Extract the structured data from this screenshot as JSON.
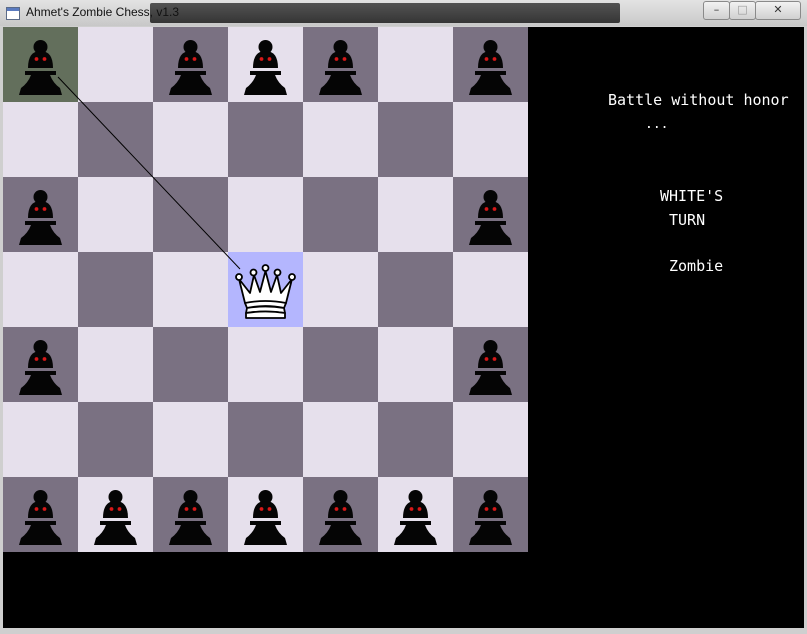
{
  "window": {
    "title": "Ahmet's Zombie Chess, v1.3",
    "controls": {
      "minimize": "–",
      "maximize": "□",
      "close": "✕"
    }
  },
  "colors": {
    "light_square": "#e6e0ec",
    "dark_square": "#7a7182",
    "last_move_square": "#636f5c",
    "selected_square": "#b4b6fe",
    "zombie_eyes": "#d81818"
  },
  "board": {
    "columns": 7,
    "rows": 7,
    "squares": [
      [
        "zombie-hl",
        "empty",
        "zombie",
        "zombie",
        "zombie",
        "empty",
        "zombie"
      ],
      [
        "empty",
        "empty",
        "empty",
        "empty",
        "empty",
        "empty",
        "empty"
      ],
      [
        "zombie",
        "empty",
        "empty",
        "empty",
        "empty",
        "empty",
        "zombie"
      ],
      [
        "empty",
        "empty",
        "empty",
        "queen-sel",
        "empty",
        "empty",
        "empty"
      ],
      [
        "zombie",
        "empty",
        "empty",
        "empty",
        "empty",
        "empty",
        "zombie"
      ],
      [
        "empty",
        "empty",
        "empty",
        "empty",
        "empty",
        "empty",
        "empty"
      ],
      [
        "zombie",
        "zombie",
        "zombie",
        "zombie",
        "zombie",
        "zombie",
        "zombie"
      ]
    ],
    "last_move": {
      "from": [
        0,
        0
      ],
      "to": [
        3,
        3
      ]
    }
  },
  "side_panel": {
    "subtitle_line1": "Battle without honor",
    "subtitle_line2": "...",
    "turn_line1": "WHITE'S",
    "turn_line2": "TURN",
    "piece_name": "Zombie"
  }
}
